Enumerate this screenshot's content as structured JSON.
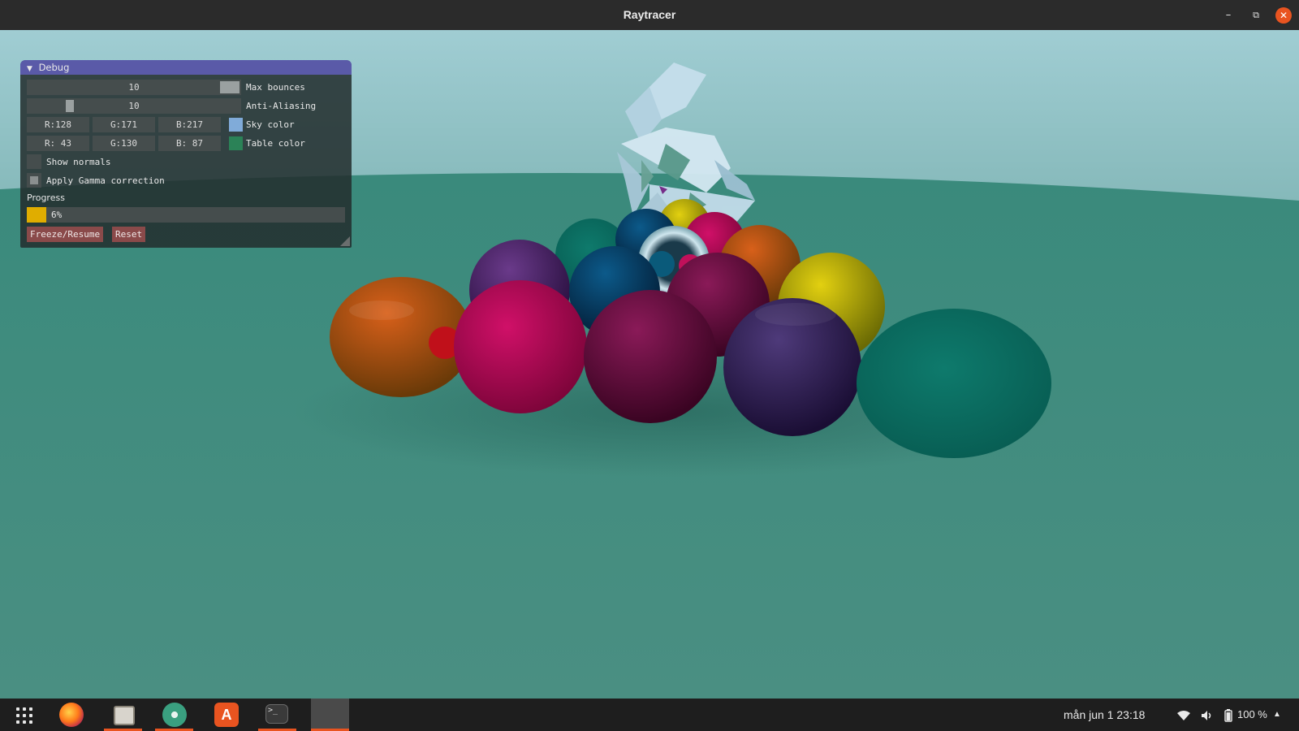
{
  "window": {
    "title": "Raytracer",
    "minimize": "–",
    "maximize": "⧉",
    "close": "✕"
  },
  "debug_panel": {
    "header": "Debug",
    "header_icon": "▼",
    "max_bounces": {
      "value": "10",
      "label": "Max bounces",
      "level": 0.9
    },
    "anti_aliasing": {
      "value": "10",
      "label": "Anti-Aliasing",
      "level": 0.2
    },
    "sky_color": {
      "r": "R:128",
      "g": "G:171",
      "b": "B:217",
      "label": "Sky color",
      "swatch": "#80abd9"
    },
    "table_color": {
      "r": "R: 43",
      "g": "G:130",
      "b": "B: 87",
      "label": "Table color",
      "swatch": "#2b8257"
    },
    "show_normals": {
      "label": "Show normals",
      "checked": false
    },
    "gamma": {
      "label": "Apply Gamma correction",
      "checked": true
    },
    "progress": {
      "label": "Progress",
      "text": "6%",
      "fraction": 0.06
    },
    "buttons": {
      "freeze": "Freeze/Resume",
      "reset": "Reset"
    }
  },
  "taskbar": {
    "apps": [
      "app-grid-icon",
      "firefox-icon",
      "files-icon",
      "atom-icon",
      "software-center-icon",
      "terminal-icon",
      "raytracer-window-icon"
    ],
    "clock": "mån jun 1  23:18",
    "battery": "100 %"
  },
  "colors": {
    "accent": "#e95420",
    "panel_header": "#5a5aa8",
    "table": "#2b8257",
    "sky": "#80abd9"
  }
}
